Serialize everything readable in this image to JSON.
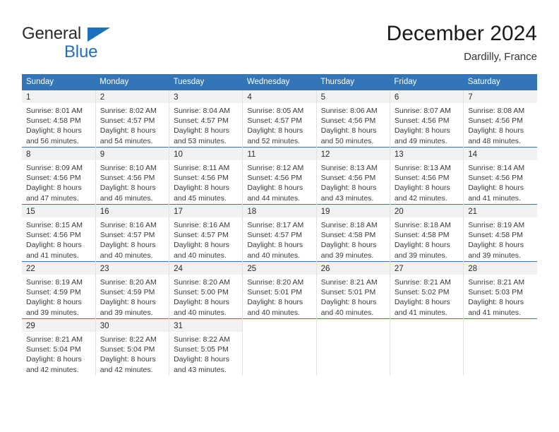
{
  "brand": {
    "word_general": "General",
    "word_blue": "Blue",
    "accent_color": "#1e6fbd"
  },
  "header": {
    "title": "December 2024",
    "location": "Dardilly, France"
  },
  "theme": {
    "header_blue": "#3275b8",
    "daynum_band": "#f2f2f2",
    "text": "#3a3a3a"
  },
  "calendar": {
    "weekday_headers": [
      "Sunday",
      "Monday",
      "Tuesday",
      "Wednesday",
      "Thursday",
      "Friday",
      "Saturday"
    ],
    "weeks": [
      [
        {
          "day": "1",
          "sunrise": "Sunrise: 8:01 AM",
          "sunset": "Sunset: 4:58 PM",
          "daylight_line1": "Daylight: 8 hours",
          "daylight_line2": "and 56 minutes."
        },
        {
          "day": "2",
          "sunrise": "Sunrise: 8:02 AM",
          "sunset": "Sunset: 4:57 PM",
          "daylight_line1": "Daylight: 8 hours",
          "daylight_line2": "and 54 minutes."
        },
        {
          "day": "3",
          "sunrise": "Sunrise: 8:04 AM",
          "sunset": "Sunset: 4:57 PM",
          "daylight_line1": "Daylight: 8 hours",
          "daylight_line2": "and 53 minutes."
        },
        {
          "day": "4",
          "sunrise": "Sunrise: 8:05 AM",
          "sunset": "Sunset: 4:57 PM",
          "daylight_line1": "Daylight: 8 hours",
          "daylight_line2": "and 52 minutes."
        },
        {
          "day": "5",
          "sunrise": "Sunrise: 8:06 AM",
          "sunset": "Sunset: 4:56 PM",
          "daylight_line1": "Daylight: 8 hours",
          "daylight_line2": "and 50 minutes."
        },
        {
          "day": "6",
          "sunrise": "Sunrise: 8:07 AM",
          "sunset": "Sunset: 4:56 PM",
          "daylight_line1": "Daylight: 8 hours",
          "daylight_line2": "and 49 minutes."
        },
        {
          "day": "7",
          "sunrise": "Sunrise: 8:08 AM",
          "sunset": "Sunset: 4:56 PM",
          "daylight_line1": "Daylight: 8 hours",
          "daylight_line2": "and 48 minutes."
        }
      ],
      [
        {
          "day": "8",
          "sunrise": "Sunrise: 8:09 AM",
          "sunset": "Sunset: 4:56 PM",
          "daylight_line1": "Daylight: 8 hours",
          "daylight_line2": "and 47 minutes."
        },
        {
          "day": "9",
          "sunrise": "Sunrise: 8:10 AM",
          "sunset": "Sunset: 4:56 PM",
          "daylight_line1": "Daylight: 8 hours",
          "daylight_line2": "and 46 minutes."
        },
        {
          "day": "10",
          "sunrise": "Sunrise: 8:11 AM",
          "sunset": "Sunset: 4:56 PM",
          "daylight_line1": "Daylight: 8 hours",
          "daylight_line2": "and 45 minutes."
        },
        {
          "day": "11",
          "sunrise": "Sunrise: 8:12 AM",
          "sunset": "Sunset: 4:56 PM",
          "daylight_line1": "Daylight: 8 hours",
          "daylight_line2": "and 44 minutes."
        },
        {
          "day": "12",
          "sunrise": "Sunrise: 8:13 AM",
          "sunset": "Sunset: 4:56 PM",
          "daylight_line1": "Daylight: 8 hours",
          "daylight_line2": "and 43 minutes."
        },
        {
          "day": "13",
          "sunrise": "Sunrise: 8:13 AM",
          "sunset": "Sunset: 4:56 PM",
          "daylight_line1": "Daylight: 8 hours",
          "daylight_line2": "and 42 minutes."
        },
        {
          "day": "14",
          "sunrise": "Sunrise: 8:14 AM",
          "sunset": "Sunset: 4:56 PM",
          "daylight_line1": "Daylight: 8 hours",
          "daylight_line2": "and 41 minutes."
        }
      ],
      [
        {
          "day": "15",
          "sunrise": "Sunrise: 8:15 AM",
          "sunset": "Sunset: 4:56 PM",
          "daylight_line1": "Daylight: 8 hours",
          "daylight_line2": "and 41 minutes."
        },
        {
          "day": "16",
          "sunrise": "Sunrise: 8:16 AM",
          "sunset": "Sunset: 4:57 PM",
          "daylight_line1": "Daylight: 8 hours",
          "daylight_line2": "and 40 minutes."
        },
        {
          "day": "17",
          "sunrise": "Sunrise: 8:16 AM",
          "sunset": "Sunset: 4:57 PM",
          "daylight_line1": "Daylight: 8 hours",
          "daylight_line2": "and 40 minutes."
        },
        {
          "day": "18",
          "sunrise": "Sunrise: 8:17 AM",
          "sunset": "Sunset: 4:57 PM",
          "daylight_line1": "Daylight: 8 hours",
          "daylight_line2": "and 40 minutes."
        },
        {
          "day": "19",
          "sunrise": "Sunrise: 8:18 AM",
          "sunset": "Sunset: 4:58 PM",
          "daylight_line1": "Daylight: 8 hours",
          "daylight_line2": "and 39 minutes."
        },
        {
          "day": "20",
          "sunrise": "Sunrise: 8:18 AM",
          "sunset": "Sunset: 4:58 PM",
          "daylight_line1": "Daylight: 8 hours",
          "daylight_line2": "and 39 minutes."
        },
        {
          "day": "21",
          "sunrise": "Sunrise: 8:19 AM",
          "sunset": "Sunset: 4:58 PM",
          "daylight_line1": "Daylight: 8 hours",
          "daylight_line2": "and 39 minutes."
        }
      ],
      [
        {
          "day": "22",
          "sunrise": "Sunrise: 8:19 AM",
          "sunset": "Sunset: 4:59 PM",
          "daylight_line1": "Daylight: 8 hours",
          "daylight_line2": "and 39 minutes."
        },
        {
          "day": "23",
          "sunrise": "Sunrise: 8:20 AM",
          "sunset": "Sunset: 4:59 PM",
          "daylight_line1": "Daylight: 8 hours",
          "daylight_line2": "and 39 minutes."
        },
        {
          "day": "24",
          "sunrise": "Sunrise: 8:20 AM",
          "sunset": "Sunset: 5:00 PM",
          "daylight_line1": "Daylight: 8 hours",
          "daylight_line2": "and 40 minutes."
        },
        {
          "day": "25",
          "sunrise": "Sunrise: 8:20 AM",
          "sunset": "Sunset: 5:01 PM",
          "daylight_line1": "Daylight: 8 hours",
          "daylight_line2": "and 40 minutes."
        },
        {
          "day": "26",
          "sunrise": "Sunrise: 8:21 AM",
          "sunset": "Sunset: 5:01 PM",
          "daylight_line1": "Daylight: 8 hours",
          "daylight_line2": "and 40 minutes."
        },
        {
          "day": "27",
          "sunrise": "Sunrise: 8:21 AM",
          "sunset": "Sunset: 5:02 PM",
          "daylight_line1": "Daylight: 8 hours",
          "daylight_line2": "and 41 minutes."
        },
        {
          "day": "28",
          "sunrise": "Sunrise: 8:21 AM",
          "sunset": "Sunset: 5:03 PM",
          "daylight_line1": "Daylight: 8 hours",
          "daylight_line2": "and 41 minutes."
        }
      ],
      [
        {
          "day": "29",
          "sunrise": "Sunrise: 8:21 AM",
          "sunset": "Sunset: 5:04 PM",
          "daylight_line1": "Daylight: 8 hours",
          "daylight_line2": "and 42 minutes."
        },
        {
          "day": "30",
          "sunrise": "Sunrise: 8:22 AM",
          "sunset": "Sunset: 5:04 PM",
          "daylight_line1": "Daylight: 8 hours",
          "daylight_line2": "and 42 minutes."
        },
        {
          "day": "31",
          "sunrise": "Sunrise: 8:22 AM",
          "sunset": "Sunset: 5:05 PM",
          "daylight_line1": "Daylight: 8 hours",
          "daylight_line2": "and 43 minutes."
        },
        {
          "day": "",
          "sunrise": "",
          "sunset": "",
          "daylight_line1": "",
          "daylight_line2": ""
        },
        {
          "day": "",
          "sunrise": "",
          "sunset": "",
          "daylight_line1": "",
          "daylight_line2": ""
        },
        {
          "day": "",
          "sunrise": "",
          "sunset": "",
          "daylight_line1": "",
          "daylight_line2": ""
        },
        {
          "day": "",
          "sunrise": "",
          "sunset": "",
          "daylight_line1": "",
          "daylight_line2": ""
        }
      ]
    ]
  }
}
